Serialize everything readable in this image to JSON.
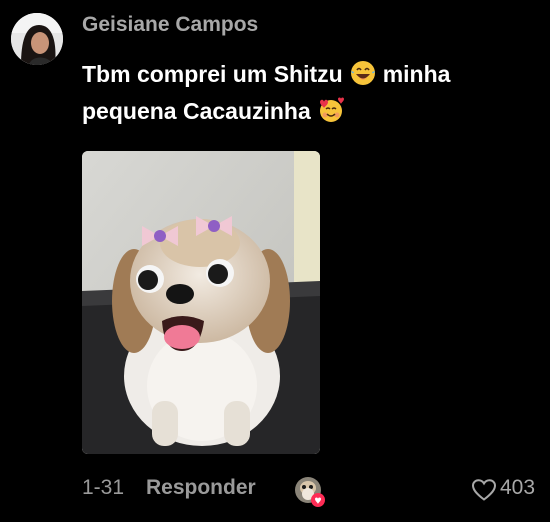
{
  "comment": {
    "username": "Geisiane Campos",
    "text_part1": "Tbm comprei um Shitzu",
    "emoji1": "face-with-tears-of-joy-icon",
    "text_part2": "minha pequena Cacauzinha",
    "emoji2": "smiling-face-with-hearts-icon",
    "date": "1-31",
    "reply_label": "Responder",
    "like_count": "403"
  },
  "colors": {
    "background": "#000000",
    "username": "#a8a8a8",
    "text": "#ffffff",
    "muted": "#9a9a9a",
    "badge": "#fe2c55"
  }
}
